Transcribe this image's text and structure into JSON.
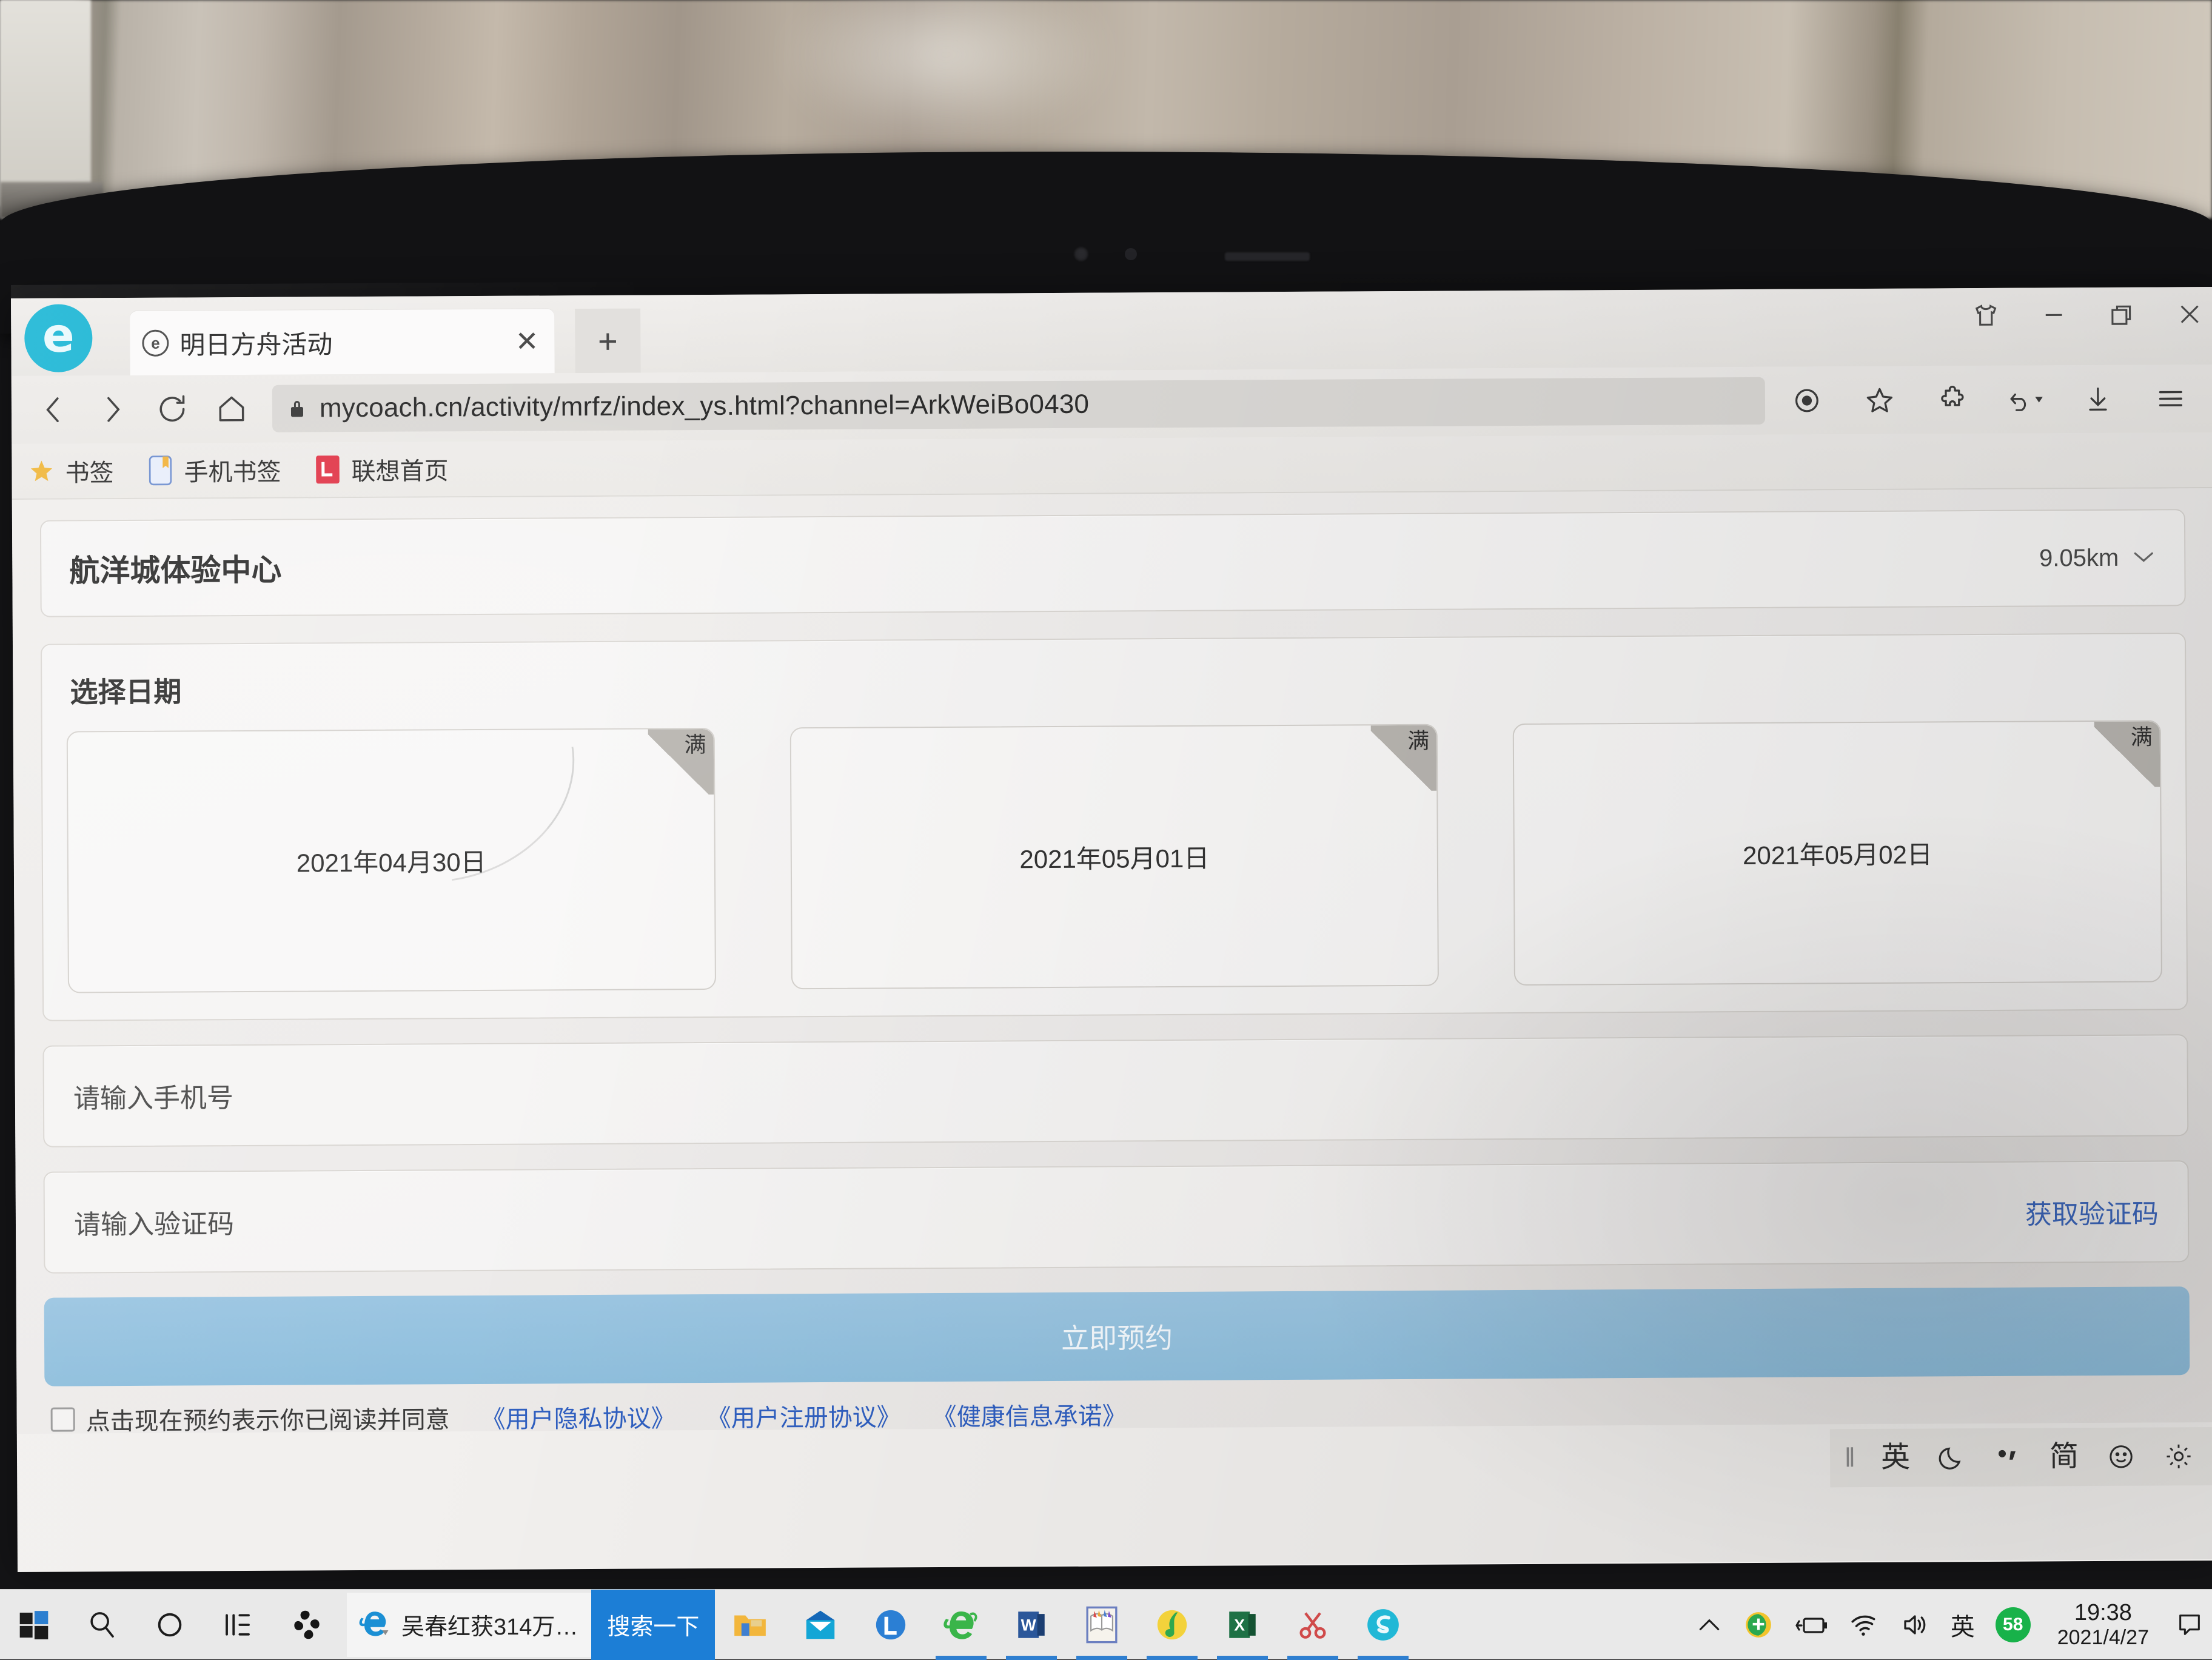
{
  "browser": {
    "brand_logo_glyph": "e",
    "tab": {
      "favicon_glyph": "e",
      "title": "明日方舟活动",
      "close_glyph": "✕"
    },
    "new_tab_glyph": "+",
    "window_controls": [
      "skin-icon",
      "minimize",
      "restore",
      "close"
    ],
    "nav": {
      "back": "back-icon",
      "forward": "forward-icon",
      "reload": "reload-icon",
      "home": "home-icon"
    },
    "omnibox": {
      "url": "mycoach.cn/activity/mrfz/index_ys.html?channel=ArkWeiBo0430",
      "secure": true
    },
    "toolbar_icons": [
      "target-icon",
      "star-icon",
      "puzzle-icon",
      "undo-dropdown-icon",
      "download-icon",
      "menu-icon"
    ],
    "bookmarks": [
      {
        "icon": "star-icon",
        "label": "书签"
      },
      {
        "icon": "phone-bookmark-icon",
        "label": "手机书签"
      },
      {
        "icon": "lenovo-icon",
        "label": "联想首页"
      }
    ]
  },
  "page": {
    "store": {
      "name": "航洋城体验中心",
      "distance": "9.05km",
      "chevron": "⌄"
    },
    "date_section": {
      "title": "选择日期",
      "cards": [
        {
          "date": "2021年04月30日",
          "badge": "满"
        },
        {
          "date": "2021年05月01日",
          "badge": "满"
        },
        {
          "date": "2021年05月02日",
          "badge": "满"
        }
      ]
    },
    "form": {
      "phone_placeholder": "请输入手机号",
      "phone_value": "",
      "code_placeholder": "请输入验证码",
      "code_value": "",
      "get_code_label": "获取验证码",
      "submit_label": "立即预约"
    },
    "agreement": {
      "checked": false,
      "prefix": "点击现在预约表示你已阅读并同意",
      "links": [
        "《用户隐私协议》",
        "《用户注册协议》",
        "《健康信息承诺》"
      ]
    },
    "accent_blue": "#8fbfdd",
    "link_blue": "#3e69c0"
  },
  "ime_bar": {
    "items": [
      "grip",
      "英",
      "moon-icon",
      "punctuation-icon",
      "简",
      "smiley-icon",
      "gear-icon"
    ],
    "lang_label": "英",
    "mode_label": "简"
  },
  "taskbar": {
    "start": "windows-start-icon",
    "search": "search-icon",
    "cortana": "cortana-icon",
    "task_view": "task-view-icon",
    "pinned_dark": "dark-app-icon",
    "news": {
      "icon": "ie-icon",
      "text": "吴春红获314万…"
    },
    "search_button_label": "搜索一下",
    "apps": [
      "file-explorer-icon",
      "mail-icon",
      "lenovo-icon",
      "internet-explorer-icon",
      "word-icon",
      "dictionary-icon",
      "music-icon",
      "excel-icon",
      "snip-icon",
      "browser-icon"
    ],
    "tray": {
      "overflow": "chevron-up-icon",
      "shield": "security-shield-icon",
      "power": "battery-icon",
      "network": "wifi-icon",
      "volume": "volume-icon",
      "ime": "英",
      "badge": "58",
      "time": "19:38",
      "date": "2021/4/27",
      "notifications": "notification-icon"
    }
  }
}
